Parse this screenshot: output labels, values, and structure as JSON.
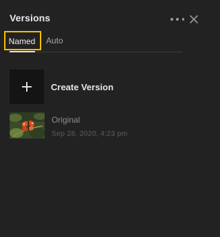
{
  "panel": {
    "title": "Versions",
    "more_icon": "more-horizontal-icon",
    "close_icon": "close-icon"
  },
  "tabs": [
    {
      "label": "Named",
      "selected": true
    },
    {
      "label": "Auto",
      "selected": false
    }
  ],
  "create_version": {
    "label": "Create Version",
    "icon": "plus-icon"
  },
  "versions": [
    {
      "name": "Original",
      "date": "Sep 28, 2020, 4:23 pm",
      "thumbnail": "butterfly-photo-thumbnail"
    }
  ],
  "colors": {
    "background": "#222222",
    "highlight_outline": "#f5c000",
    "create_tile": "#141414"
  }
}
